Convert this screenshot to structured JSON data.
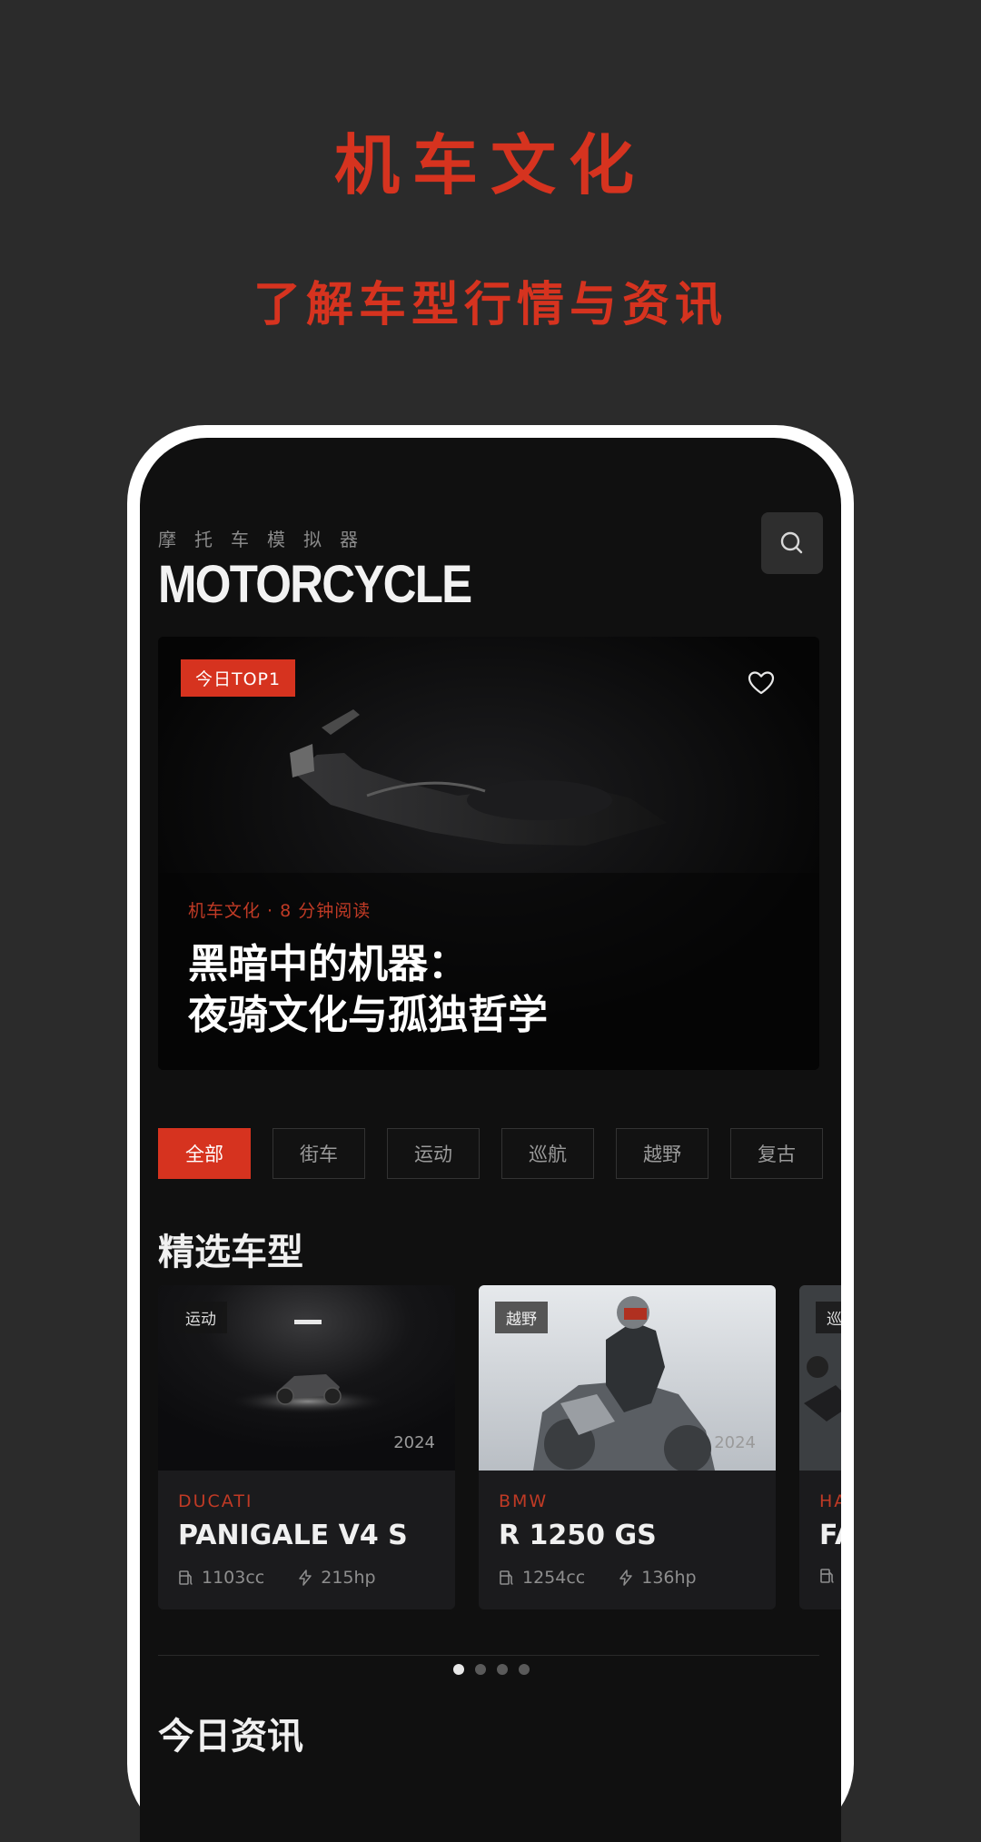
{
  "promo": {
    "title": "机车文化",
    "subtitle": "了解车型行情与资讯"
  },
  "header": {
    "subtitle": "摩托车模拟器",
    "brand": "MOTORCYCLE",
    "search_icon": "search-icon"
  },
  "hero": {
    "badge": "今日TOP1",
    "meta": "机车文化 · 8 分钟阅读",
    "title_line1": "黑暗中的机器：",
    "title_line2": "夜骑文化与孤独哲学",
    "heart_icon": "heart-icon"
  },
  "filters": [
    "全部",
    "街车",
    "运动",
    "巡航",
    "越野",
    "复古"
  ],
  "active_filter": "全部",
  "featured": {
    "title": "精选车型",
    "cards": [
      {
        "tag": "运动",
        "year": "2024",
        "brand": "DUCATI",
        "model": "PANIGALE V4 S",
        "displacement": "1103cc",
        "power": "215hp"
      },
      {
        "tag": "越野",
        "year": "2024",
        "brand": "BMW",
        "model": "R 1250 GS",
        "displacement": "1254cc",
        "power": "136hp"
      },
      {
        "tag": "巡",
        "year": "",
        "brand": "HA",
        "model": "FA",
        "displacement": "",
        "power": ""
      }
    ],
    "pagination": {
      "current": 1,
      "total": 4
    }
  },
  "news": {
    "title": "今日资讯"
  },
  "colors": {
    "accent": "#d6331f",
    "background": "#2b2b2b",
    "screen": "#101010",
    "card": "#1b1b1d"
  }
}
